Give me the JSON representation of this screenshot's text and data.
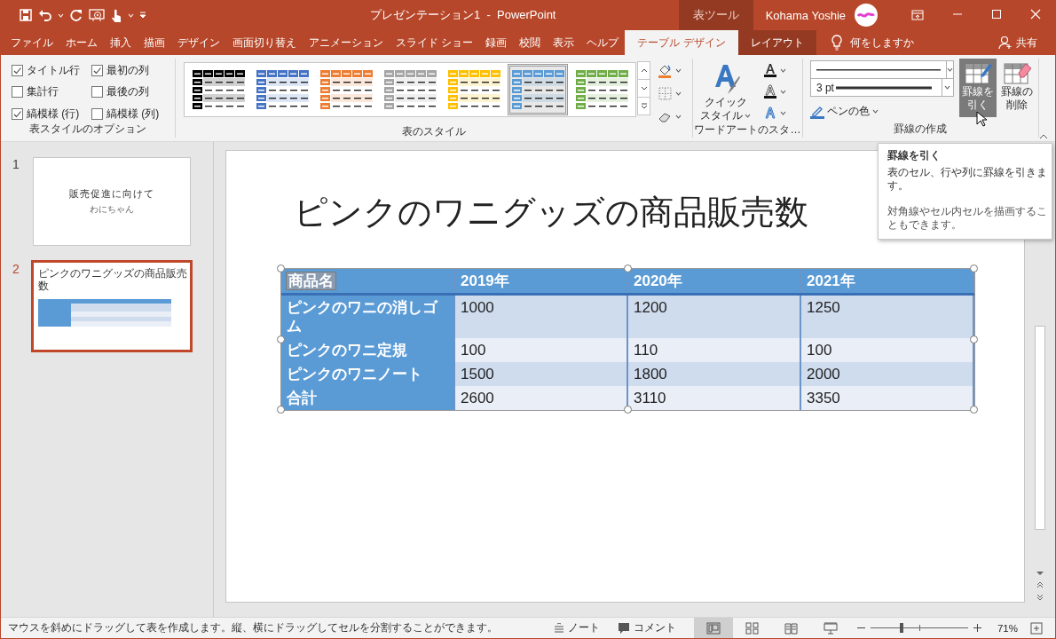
{
  "window": {
    "title": "プレゼンテーション1  -  PowerPoint",
    "context_header": "表ツール",
    "user": "Kohama Yoshie"
  },
  "tabs": [
    {
      "label": "ファイル",
      "selected": false,
      "kind": "normal"
    },
    {
      "label": "ホーム",
      "selected": false,
      "kind": "normal"
    },
    {
      "label": "挿入",
      "selected": false,
      "kind": "normal"
    },
    {
      "label": "描画",
      "selected": false,
      "kind": "normal"
    },
    {
      "label": "デザイン",
      "selected": false,
      "kind": "normal"
    },
    {
      "label": "画面切り替え",
      "selected": false,
      "kind": "normal"
    },
    {
      "label": "アニメーション",
      "selected": false,
      "kind": "normal"
    },
    {
      "label": "スライド ショー",
      "selected": false,
      "kind": "normal"
    },
    {
      "label": "録画",
      "selected": false,
      "kind": "normal"
    },
    {
      "label": "校閲",
      "selected": false,
      "kind": "normal"
    },
    {
      "label": "表示",
      "selected": false,
      "kind": "normal"
    },
    {
      "label": "ヘルプ",
      "selected": false,
      "kind": "normal"
    },
    {
      "label": "テーブル デザイン",
      "selected": true,
      "kind": "context"
    },
    {
      "label": "レイアウト",
      "selected": false,
      "kind": "context"
    }
  ],
  "tell_me": "何をしますか",
  "share": "共有",
  "ribbon": {
    "options": {
      "label": "表スタイルのオプション",
      "items": [
        {
          "label": "タイトル行",
          "checked": true
        },
        {
          "label": "最初の列",
          "checked": true
        },
        {
          "label": "集計行",
          "checked": false
        },
        {
          "label": "最後の列",
          "checked": false
        },
        {
          "label": "縞模様 (行)",
          "checked": true
        },
        {
          "label": "縞模様 (列)",
          "checked": false
        }
      ]
    },
    "styles": {
      "label": "表のスタイル",
      "items": [
        {
          "color": "#000000",
          "selected": false
        },
        {
          "color": "#4472c4",
          "selected": false
        },
        {
          "color": "#ed7d31",
          "selected": false
        },
        {
          "color": "#a5a5a5",
          "selected": false
        },
        {
          "color": "#ffc000",
          "selected": false
        },
        {
          "color": "#5b9bd5",
          "selected": true
        },
        {
          "color": "#70ad47",
          "selected": false
        }
      ]
    },
    "wordart": {
      "label": "ワードアートのスタ…",
      "quick_style": [
        "クイック",
        "スタイル"
      ]
    },
    "borders": {
      "label": "罫線の作成",
      "pen_weight": "3 pt",
      "pen_color": "ペンの色",
      "buttons": [
        {
          "label": [
            "罫線を",
            "引く"
          ],
          "kind": "draw",
          "selected": true
        },
        {
          "label": [
            "罫線の",
            "削除"
          ],
          "kind": "erase",
          "selected": false
        }
      ]
    }
  },
  "tooltip": {
    "title": "罫線を引く",
    "lines": [
      "表のセル、行や列に罫線を引きます。",
      "対角線やセル内セルを描画することもできます。"
    ]
  },
  "thumbnails": [
    {
      "number": "1",
      "selected": false,
      "kind": "title",
      "title": "販売促進に向けて",
      "subtitle": "わにちゃん"
    },
    {
      "number": "2",
      "selected": true,
      "kind": "table",
      "title": "ピンクのワニグッズの商品販売数"
    }
  ],
  "slide": {
    "title": "ピンクのワニグッズの商品販売数",
    "table": {
      "columns": [
        "商品名",
        "2019年",
        "2020年",
        "2021年"
      ],
      "rows": [
        [
          "ピンクのワニの消しゴム",
          "1000",
          "1200",
          "1250"
        ],
        [
          "ピンクのワニ定規",
          "100",
          "110",
          "100"
        ],
        [
          "ピンクのワニノート",
          "1500",
          "1800",
          "2000"
        ],
        [
          "合計",
          "2600",
          "3110",
          "3350"
        ]
      ]
    }
  },
  "status_bar": {
    "message": "マウスを斜めにドラッグして表を作成します。縦、横にドラッグしてセルを分割することができます。",
    "notes": "ノート",
    "comments": "コメント",
    "views": [
      {
        "kind": "normal",
        "selected": true
      },
      {
        "kind": "sorter",
        "selected": false
      },
      {
        "kind": "reading",
        "selected": false
      },
      {
        "kind": "show",
        "selected": false
      }
    ],
    "zoom": {
      "level": 0.32,
      "reading": "71%"
    }
  }
}
